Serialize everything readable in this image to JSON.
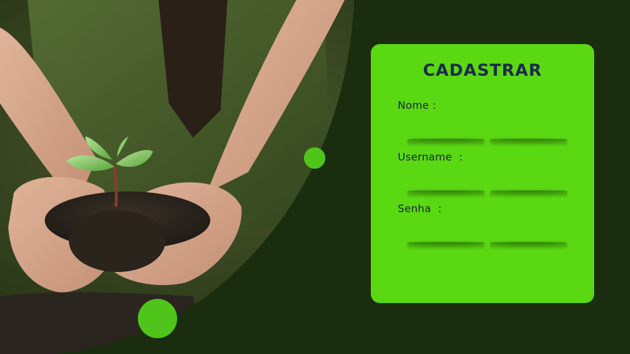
{
  "form": {
    "title": "CADASTRAR",
    "fields": [
      {
        "label": "Nome :",
        "value": ""
      },
      {
        "label": "Username  :",
        "value": ""
      },
      {
        "label": "Senha  :",
        "value": ""
      }
    ]
  },
  "image": {
    "subject": "hands holding soil with a sprouting seedling"
  },
  "colors": {
    "background": "#1b2d0f",
    "card": "#5ad812",
    "title": "#1c2a4d",
    "accent_dot": "#4fc51b"
  }
}
